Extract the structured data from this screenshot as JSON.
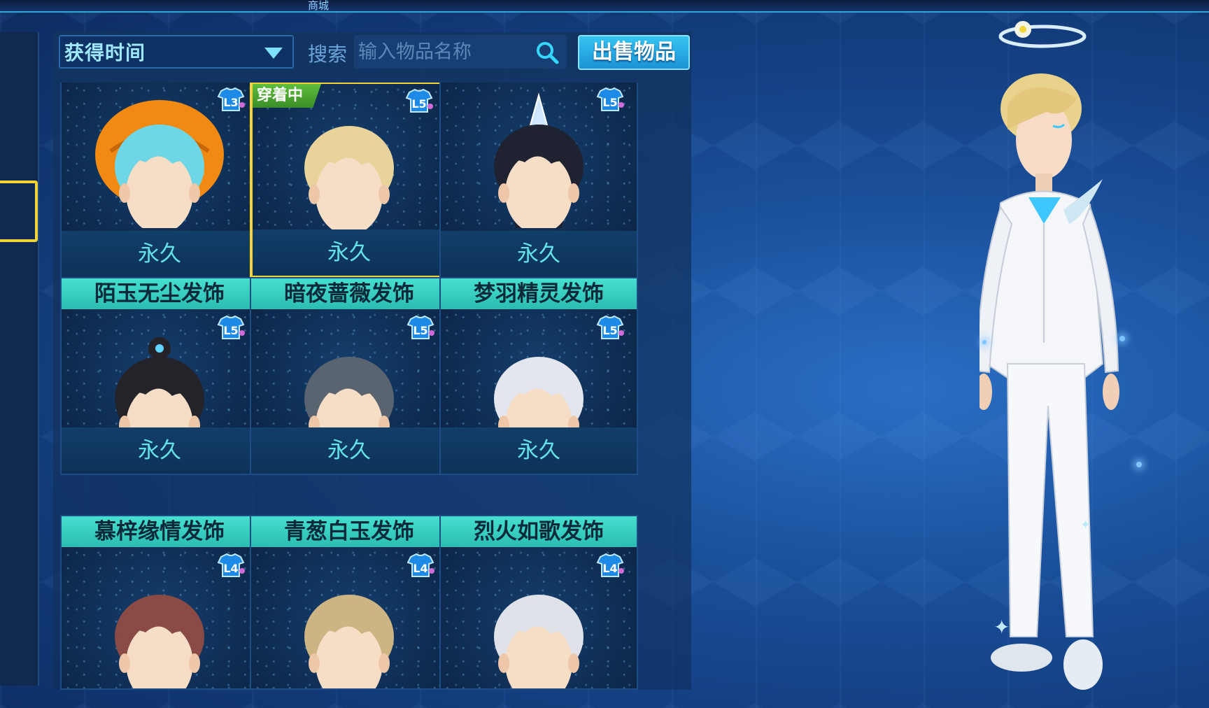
{
  "top": {
    "tab_fragment": "商城"
  },
  "toolbar": {
    "sort_label": "获得时间",
    "search_label": "搜索",
    "search_placeholder": "输入物品名称",
    "sell_button": "出售物品"
  },
  "items": [
    {
      "name": "",
      "duration": "永久",
      "level": "L3",
      "hair": "pumpkin",
      "wearing": false,
      "selected": false
    },
    {
      "name": "",
      "duration": "永久",
      "level": "L5",
      "hair": "blonde",
      "wearing": true,
      "wearing_label": "穿着中",
      "selected": true
    },
    {
      "name": "",
      "duration": "永久",
      "level": "L5",
      "hair": "black-crown",
      "wearing": false,
      "selected": false
    },
    {
      "name": "陌玉无尘发饰",
      "duration": "永久",
      "level": "L5",
      "hair": "black-bun",
      "wearing": false,
      "selected": false
    },
    {
      "name": "暗夜蔷薇发饰",
      "duration": "永久",
      "level": "L5",
      "hair": "dark-gray",
      "wearing": false,
      "selected": false
    },
    {
      "name": "梦羽精灵发饰",
      "duration": "永久",
      "level": "L5",
      "hair": "silver",
      "wearing": false,
      "selected": false
    },
    {
      "name": "慕梓缘情发饰",
      "duration": "",
      "level": "L4",
      "hair": "auburn",
      "wearing": false,
      "selected": false
    },
    {
      "name": "青葱白玉发饰",
      "duration": "",
      "level": "L4",
      "hair": "sandy",
      "wearing": false,
      "selected": false
    },
    {
      "name": "烈火如歌发饰",
      "duration": "",
      "level": "L4",
      "hair": "white",
      "wearing": false,
      "selected": false
    }
  ],
  "colors": {
    "accent": "#2fb8ea",
    "name_bar": "#3fd6c6",
    "selected_border": "#f2d33a",
    "wearing_tag": "#4fa832",
    "duration_text": "#64e1e6"
  }
}
